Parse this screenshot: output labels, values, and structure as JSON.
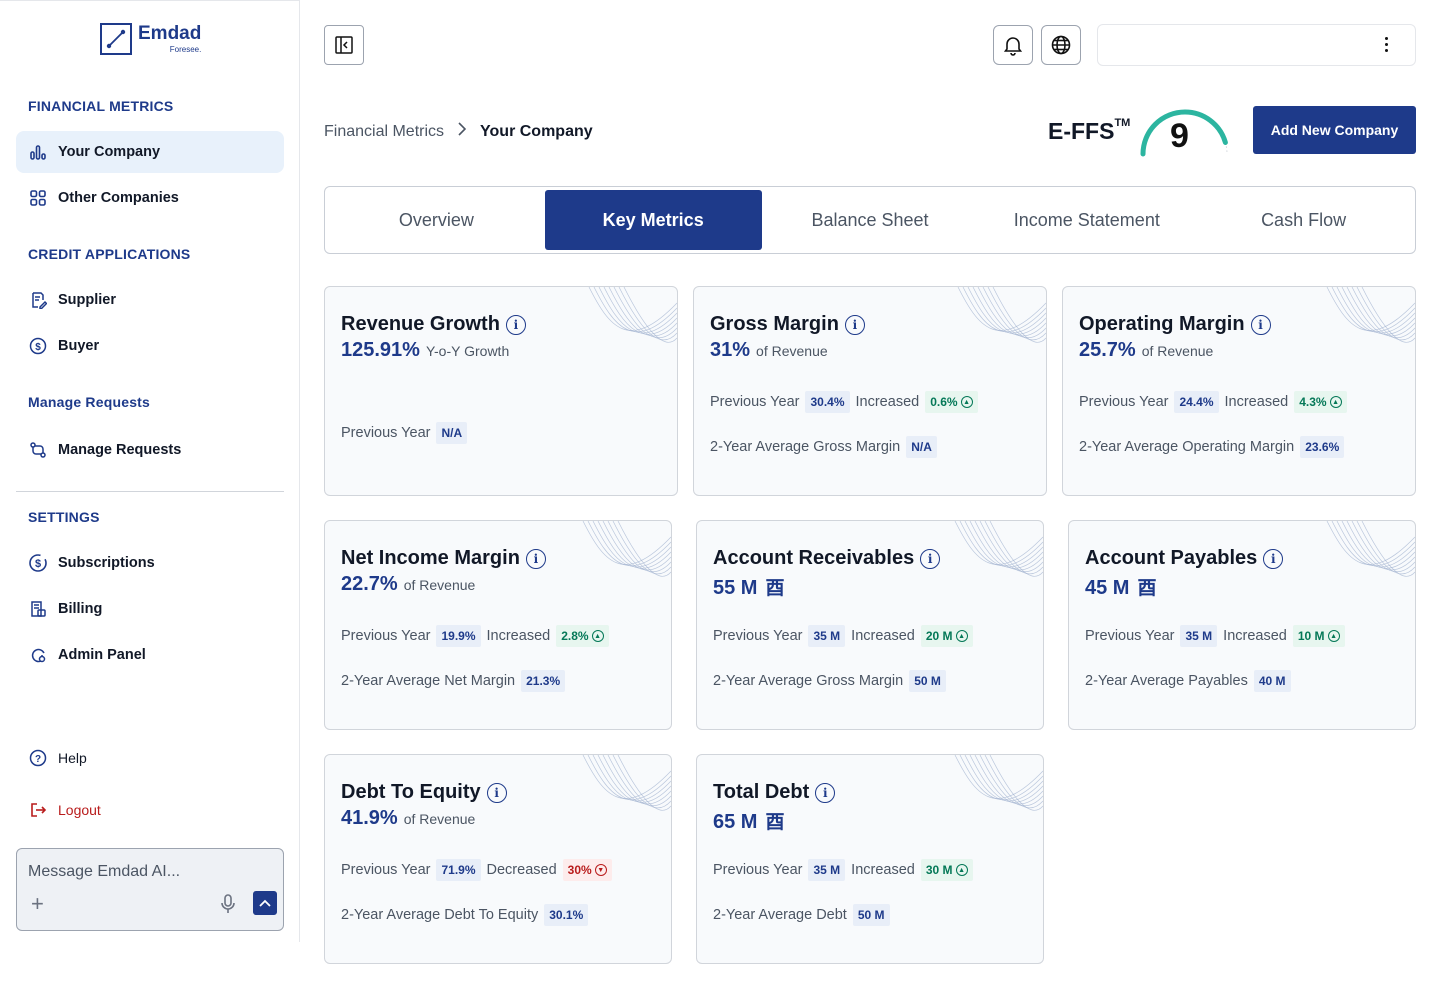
{
  "brand": {
    "name": "Emdad",
    "tagline": "Foresee."
  },
  "sidebar": {
    "sections": {
      "financial": "FINANCIAL METRICS",
      "credit": "CREDIT APPLICATIONS",
      "requests": "Manage Requests",
      "settings": "SETTINGS"
    },
    "items": {
      "your_company": "Your Company",
      "other_companies": "Other Companies",
      "supplier": "Supplier",
      "buyer": "Buyer",
      "manage_requests": "Manage Requests",
      "subscriptions": "Subscriptions",
      "billing": "Billing",
      "admin_panel": "Admin Panel",
      "help": "Help",
      "logout": "Logout"
    },
    "chat": {
      "placeholder": "Message Emdad AI..."
    }
  },
  "header": {
    "breadcrumb": {
      "parent": "Financial Metrics",
      "current": "Your Company"
    },
    "effs_label": "E-FFS",
    "effs_tm": "TM",
    "effs_score": "9",
    "add_company": "Add New Company"
  },
  "tabs": [
    "Overview",
    "Key Metrics",
    "Balance Sheet",
    "Income Statement",
    "Cash Flow"
  ],
  "cards": {
    "revenue_growth": {
      "title": "Revenue Growth",
      "value": "125.91%",
      "unit": "Y-o-Y Growth",
      "prev_label": "Previous Year",
      "prev": "N/A"
    },
    "gross_margin": {
      "title": "Gross Margin",
      "value": "31%",
      "unit": "of Revenue",
      "prev_label": "Previous Year",
      "prev": "30.4%",
      "trend": "Increased",
      "delta": "0.6%",
      "avg_label": "2-Year Average Gross Margin",
      "avg": "N/A"
    },
    "operating_margin": {
      "title": "Operating Margin",
      "value": "25.7%",
      "unit": "of Revenue",
      "prev_label": "Previous Year",
      "prev": "24.4%",
      "trend": "Increased",
      "delta": "4.3%",
      "avg_label": "2-Year Average Operating Margin",
      "avg": "23.6%"
    },
    "net_income_margin": {
      "title": "Net Income Margin",
      "value": "22.7%",
      "unit": "of Revenue",
      "prev_label": "Previous Year",
      "prev": "19.9%",
      "trend": "Increased",
      "delta": "2.8%",
      "avg_label": "2-Year Average Net Margin",
      "avg": "21.3%"
    },
    "account_receivables": {
      "title": "Account Receivables",
      "value": "55 M",
      "prev_label": "Previous Year",
      "prev": "35 M",
      "trend": "Increased",
      "delta": "20 M",
      "avg_label": "2-Year Average Gross Margin",
      "avg": "50 M"
    },
    "account_payables": {
      "title": "Account Payables",
      "value": "45 M",
      "prev_label": "Previous Year",
      "prev": "35 M",
      "trend": "Increased",
      "delta": "10 M",
      "avg_label": "2-Year Average Payables",
      "avg": "40 M"
    },
    "debt_to_equity": {
      "title": "Debt To Equity",
      "value": "41.9%",
      "unit": "of Revenue",
      "prev_label": "Previous Year",
      "prev": "71.9%",
      "trend": "Decreased",
      "delta": "30%",
      "avg_label": "2-Year Average Debt To Equity",
      "avg": "30.1%"
    },
    "total_debt": {
      "title": "Total Debt",
      "value": "65 M",
      "prev_label": "Previous Year",
      "prev": "35 M",
      "trend": "Increased",
      "delta": "30 M",
      "avg_label": "2-Year Average Debt",
      "avg": "50 M"
    }
  },
  "colors": {
    "primary": "#1e3a8a",
    "increase": "#047857",
    "decrease": "#b91c1c",
    "gauge": "#2cb5a0"
  },
  "icons": {
    "info": "info-icon",
    "currency": "riyal-icon",
    "up": "arrow-up-icon",
    "down": "arrow-down-icon"
  }
}
